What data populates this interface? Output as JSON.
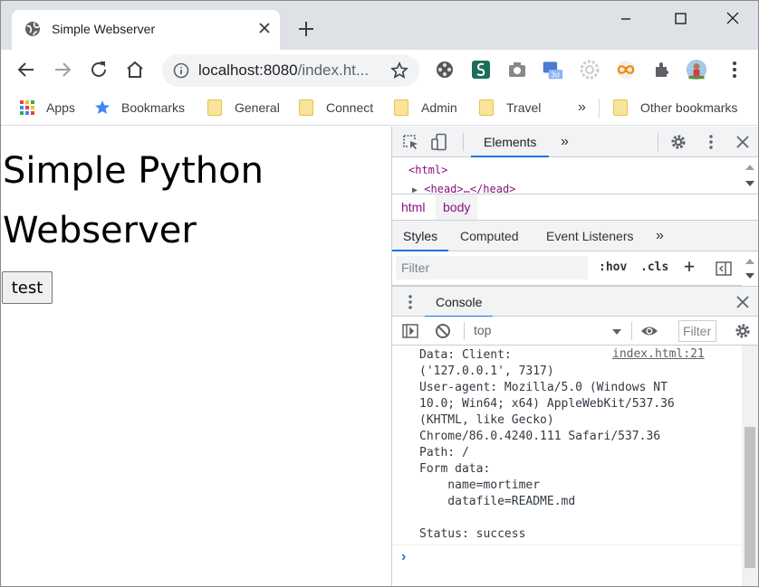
{
  "browser": {
    "tab_title": "Simple Webserver",
    "url_host": "localhost:8080",
    "url_path": "/index.ht..."
  },
  "bookmarks": {
    "apps": "Apps",
    "bookmarks": "Bookmarks",
    "general": "General",
    "connect": "Connect",
    "admin": "Admin",
    "travel": "Travel",
    "more": "»",
    "other": "Other bookmarks"
  },
  "page": {
    "heading": "Simple Python Webserver",
    "button_label": "test"
  },
  "devtools": {
    "tab_elements": "Elements",
    "more_tabs": "»",
    "dom_html": "<html>",
    "dom_head": "<head>…</head>",
    "crumb_html": "html",
    "crumb_body": "body",
    "styles_tab": "Styles",
    "computed_tab": "Computed",
    "listeners_tab": "Event Listeners",
    "styles_more": "»",
    "filter_placeholder": "Filter",
    "hov": ":hov",
    "cls": ".cls",
    "plus": "+",
    "drawer_console": "Console",
    "context": "top",
    "console_filter": "Filter",
    "console_message": "Data: Client:\n('127.0.0.1', 7317)\nUser-agent: Mozilla/5.0 (Windows NT\n10.0; Win64; x64) AppleWebKit/537.36\n(KHTML, like Gecko)\nChrome/86.0.4240.111 Safari/537.36\nPath: /\nForm data:\n    name=mortimer\n    datafile=README.md\n\nStatus: success",
    "console_source": "index.html:21",
    "prompt_symbol": "›"
  },
  "colors": {
    "accent": "#1a73e8",
    "tag": "#881280"
  },
  "icons": [
    "globe-icon",
    "close-icon",
    "plus-icon",
    "minimize-icon",
    "maximize-icon",
    "back-icon",
    "forward-icon",
    "reload-icon",
    "home-icon",
    "info-icon",
    "star-icon",
    "extensions-icon",
    "menu-icon",
    "inspect-icon",
    "device-icon",
    "gear-icon",
    "clear-console-icon",
    "eye-icon"
  ]
}
